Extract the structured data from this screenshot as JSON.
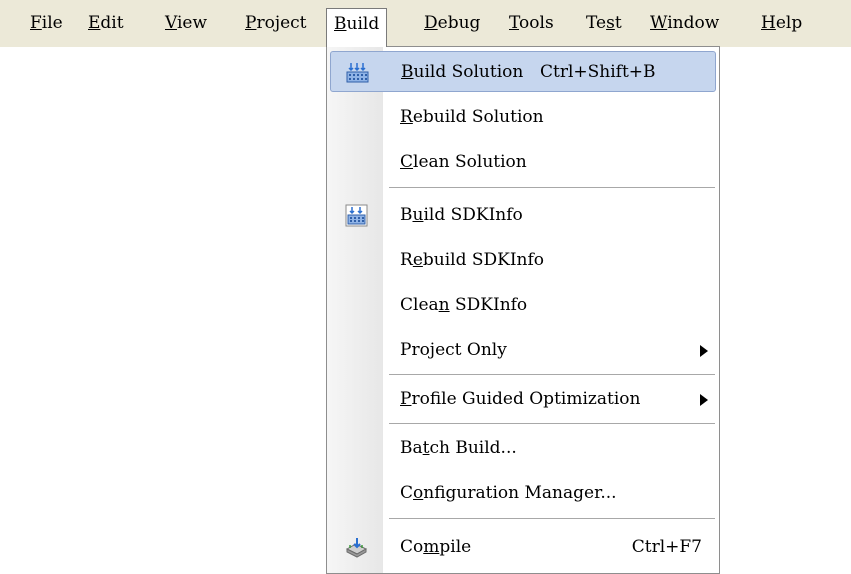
{
  "menubar": {
    "items": [
      {
        "prefix": "",
        "accel": "F",
        "suffix": "ile"
      },
      {
        "prefix": "",
        "accel": "E",
        "suffix": "dit"
      },
      {
        "prefix": "",
        "accel": "V",
        "suffix": "iew"
      },
      {
        "prefix": "",
        "accel": "P",
        "suffix": "roject"
      },
      {
        "prefix": "",
        "accel": "B",
        "suffix": "uild"
      },
      {
        "prefix": "",
        "accel": "D",
        "suffix": "ebug"
      },
      {
        "prefix": "",
        "accel": "T",
        "suffix": "ools"
      },
      {
        "prefix": "Te",
        "accel": "s",
        "suffix": "t"
      },
      {
        "prefix": "",
        "accel": "W",
        "suffix": "indow"
      },
      {
        "prefix": "",
        "accel": "H",
        "suffix": "elp"
      }
    ]
  },
  "build_menu": {
    "items": [
      {
        "prefix": "",
        "accel": "B",
        "suffix": "uild Solution",
        "shortcut": "Ctrl+Shift+B",
        "icon": "build-solution-icon"
      },
      {
        "prefix": "",
        "accel": "R",
        "suffix": "ebuild Solution"
      },
      {
        "prefix": "",
        "accel": "C",
        "suffix": "lean Solution"
      },
      {
        "prefix": "B",
        "accel": "u",
        "suffix": "ild SDKInfo",
        "icon": "build-project-icon"
      },
      {
        "prefix": "R",
        "accel": "e",
        "suffix": "build SDKInfo"
      },
      {
        "prefix": "Clea",
        "accel": "n",
        "suffix": " SDKInfo"
      },
      {
        "prefix": "Project Only",
        "accel": "",
        "suffix": "",
        "submenu": true
      },
      {
        "prefix": "",
        "accel": "P",
        "suffix": "rofile Guided Optimization",
        "submenu": true
      },
      {
        "prefix": "Ba",
        "accel": "t",
        "suffix": "ch Build..."
      },
      {
        "prefix": "C",
        "accel": "o",
        "suffix": "nfiguration Manager..."
      },
      {
        "prefix": "Co",
        "accel": "m",
        "suffix": "pile",
        "shortcut": "Ctrl+F7",
        "icon": "compile-icon"
      }
    ]
  }
}
